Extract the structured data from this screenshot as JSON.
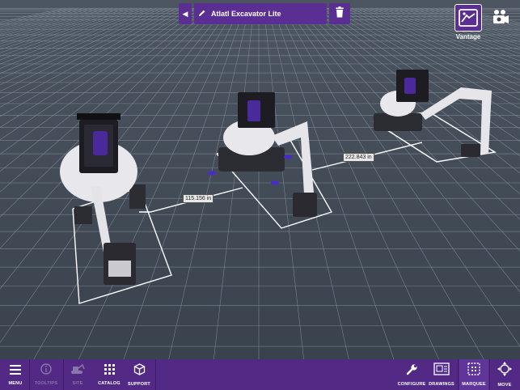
{
  "title_bar": {
    "back_icon": "chevron-left-icon",
    "edit_icon": "pencil-icon",
    "title": "Atlatl Excavator Lite",
    "delete_icon": "trash-icon"
  },
  "vantage": {
    "label": "Vantage",
    "icon": "vantage-icon"
  },
  "camera": {
    "icon": "camera-icon"
  },
  "measurements": [
    {
      "label": "115.156 in"
    },
    {
      "label": "222.843 in"
    }
  ],
  "toolbar": {
    "left": [
      {
        "label": "MENU",
        "icon": "hamburger-icon",
        "enabled": true
      },
      {
        "label": "TOOLTIPS",
        "icon": "info-icon",
        "enabled": false
      },
      {
        "label": "SITE",
        "icon": "excavator-icon",
        "enabled": false
      },
      {
        "label": "CATALOG",
        "icon": "grid-icon",
        "enabled": true
      },
      {
        "label": "SUPPORT",
        "icon": "cube-icon",
        "enabled": true
      }
    ],
    "right": [
      {
        "label": "CONFIGURE",
        "icon": "wrench-icon",
        "enabled": true
      },
      {
        "label": "DRAWINGS",
        "icon": "drawings-icon",
        "enabled": true
      },
      {
        "label": "MARQUEE",
        "icon": "marquee-icon",
        "enabled": true
      },
      {
        "label": "MOVE",
        "icon": "move-icon",
        "enabled": true
      }
    ]
  },
  "colors": {
    "accent": "#5a2e92",
    "toolbar": "#522a86",
    "floor": "#3e4750",
    "grid": "#8c98a6",
    "machine_body": "#e8e8ec",
    "cab_seat": "#4a2a9a"
  }
}
